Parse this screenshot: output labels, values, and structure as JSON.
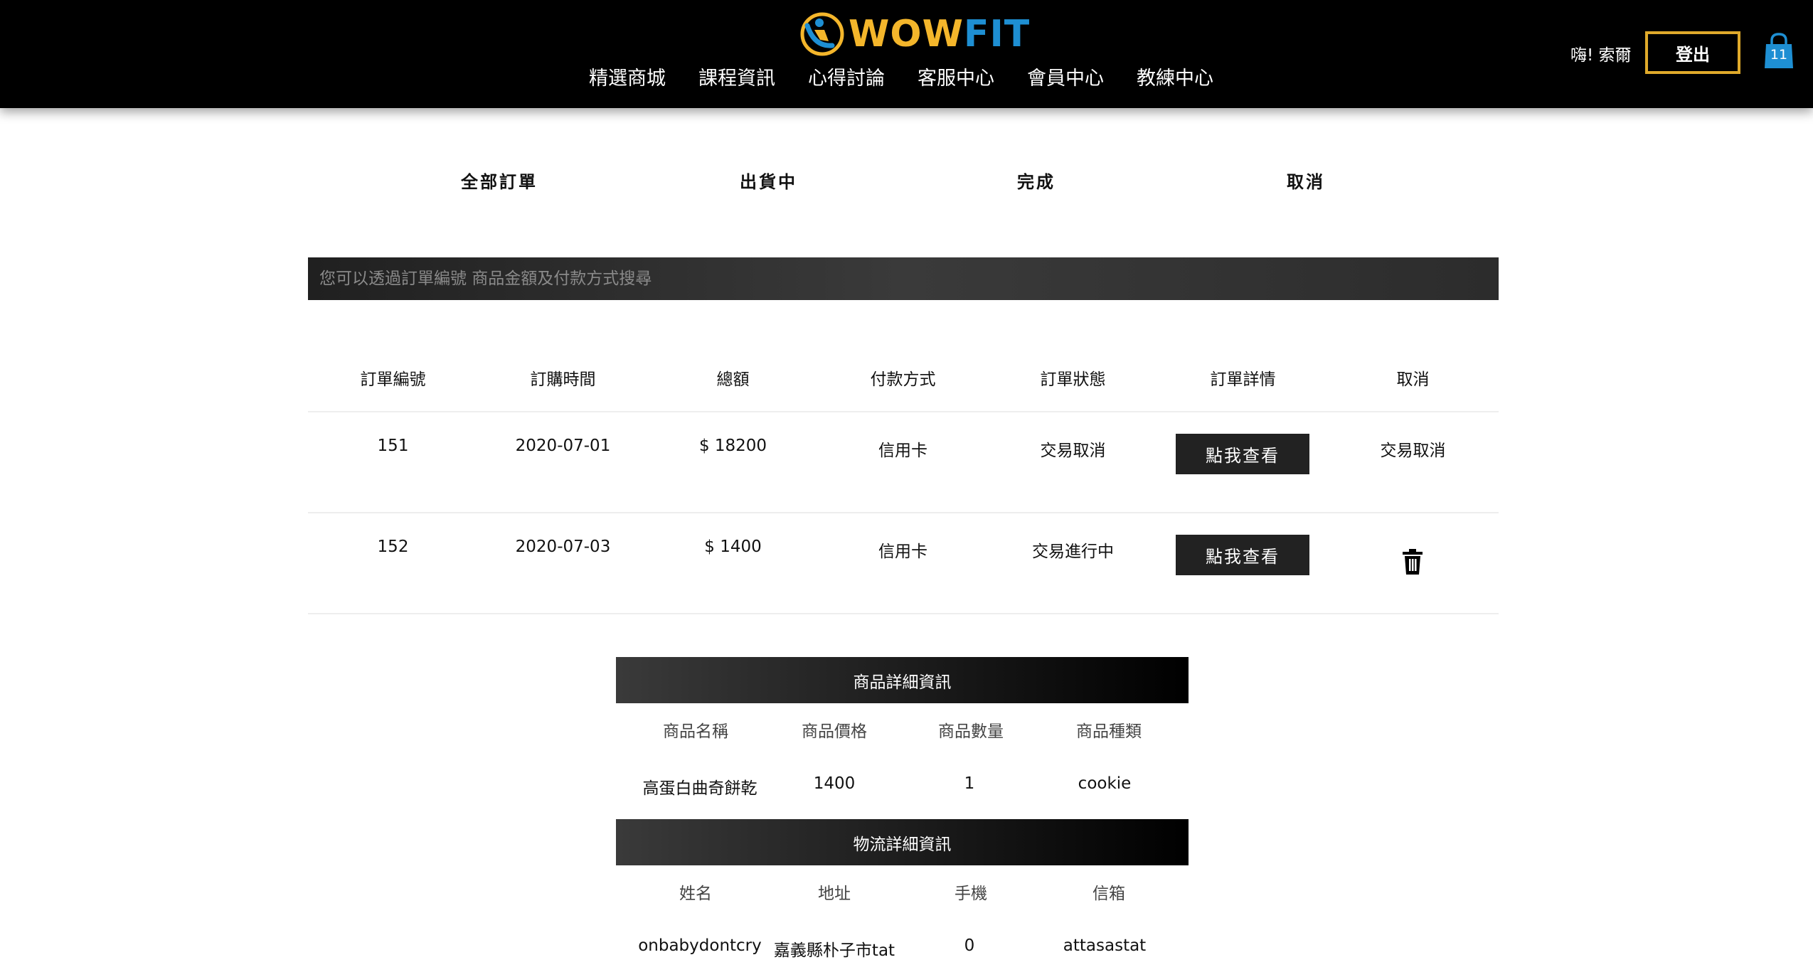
{
  "header": {
    "logo_wow": "WOW",
    "logo_fit": "FIT",
    "nav": [
      "精選商城",
      "課程資訊",
      "心得討論",
      "客服中心",
      "會員中心",
      "教練中心"
    ],
    "greeting": "嗨! 索爾",
    "logout_label": "登出",
    "cart_count": "11",
    "colors": {
      "accent_gold": "#e0aa2b",
      "brand_blue": "#1e8fd3",
      "brand_yellow": "#f4b62b"
    },
    "icons": {
      "cart": "shopping-bag-icon"
    }
  },
  "tabs": [
    "全部訂單",
    "出貨中",
    "完成",
    "取消"
  ],
  "search": {
    "placeholder": "您可以透過訂單編號 商品金額及付款方式搜尋"
  },
  "orders": {
    "columns": [
      "訂單編號",
      "訂購時間",
      "總額",
      "付款方式",
      "訂單狀態",
      "訂單詳情",
      "取消"
    ],
    "rows": [
      {
        "id": "151",
        "date": "2020-07-01",
        "total": "$ 18200",
        "payment": "信用卡",
        "status": "交易取消",
        "detail_label": "點我查看",
        "cancel_text": "交易取消"
      },
      {
        "id": "152",
        "date": "2020-07-03",
        "total": "$ 1400",
        "payment": "信用卡",
        "status": "交易進行中",
        "detail_label": "點我查看",
        "cancel_icon": "trash-icon"
      }
    ]
  },
  "product_detail": {
    "title": "商品詳細資訊",
    "columns": [
      "商品名稱",
      "商品價格",
      "商品數量",
      "商品種類"
    ],
    "values": [
      "高蛋白曲奇餅乾",
      "1400",
      "1",
      "cookie"
    ]
  },
  "shipping_detail": {
    "title": "物流詳細資訊",
    "columns": [
      "姓名",
      "地址",
      "手機",
      "信箱"
    ],
    "values": [
      "onbabydontcry",
      "嘉義縣朴子市tat",
      "0",
      "attasastat"
    ]
  }
}
